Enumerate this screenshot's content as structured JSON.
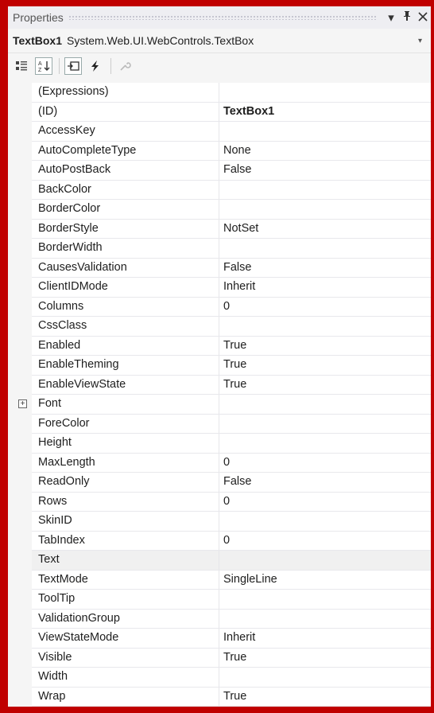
{
  "panel": {
    "title": "Properties",
    "pin_glyph": "▾",
    "dock_glyph": "ᵽ",
    "close_glyph": "✕"
  },
  "object": {
    "name": "TextBox1",
    "type": "System.Web.UI.WebControls.TextBox"
  },
  "toolbar": {
    "icons": [
      "categorized-icon",
      "alphabetical-icon",
      "properties-icon",
      "events-icon",
      "property-pages-icon"
    ]
  },
  "properties": [
    {
      "name": "(Expressions)",
      "value": ""
    },
    {
      "name": "(ID)",
      "value": "TextBox1",
      "bold": true
    },
    {
      "name": "AccessKey",
      "value": ""
    },
    {
      "name": "AutoCompleteType",
      "value": "None"
    },
    {
      "name": "AutoPostBack",
      "value": "False"
    },
    {
      "name": "BackColor",
      "value": ""
    },
    {
      "name": "BorderColor",
      "value": ""
    },
    {
      "name": "BorderStyle",
      "value": "NotSet"
    },
    {
      "name": "BorderWidth",
      "value": ""
    },
    {
      "name": "CausesValidation",
      "value": "False"
    },
    {
      "name": "ClientIDMode",
      "value": "Inherit"
    },
    {
      "name": "Columns",
      "value": "0"
    },
    {
      "name": "CssClass",
      "value": ""
    },
    {
      "name": "Enabled",
      "value": "True"
    },
    {
      "name": "EnableTheming",
      "value": "True"
    },
    {
      "name": "EnableViewState",
      "value": "True"
    },
    {
      "name": "Font",
      "value": "",
      "expandable": true
    },
    {
      "name": "ForeColor",
      "value": ""
    },
    {
      "name": "Height",
      "value": ""
    },
    {
      "name": "MaxLength",
      "value": "0"
    },
    {
      "name": "ReadOnly",
      "value": "False"
    },
    {
      "name": "Rows",
      "value": "0"
    },
    {
      "name": "SkinID",
      "value": ""
    },
    {
      "name": "TabIndex",
      "value": "0"
    },
    {
      "name": "Text",
      "value": "",
      "selected": true
    },
    {
      "name": "TextMode",
      "value": "SingleLine"
    },
    {
      "name": "ToolTip",
      "value": ""
    },
    {
      "name": "ValidationGroup",
      "value": ""
    },
    {
      "name": "ViewStateMode",
      "value": "Inherit"
    },
    {
      "name": "Visible",
      "value": "True"
    },
    {
      "name": "Width",
      "value": ""
    },
    {
      "name": "Wrap",
      "value": "True"
    }
  ]
}
